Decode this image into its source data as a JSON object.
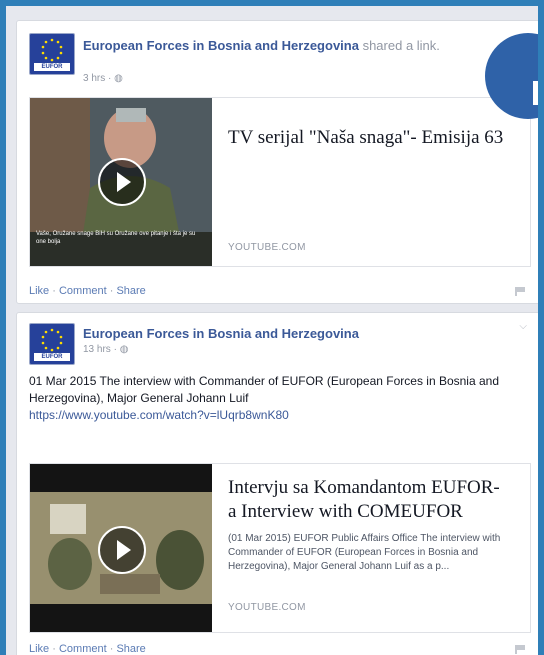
{
  "posts": [
    {
      "page_name": "European Forces in Bosnia and Herzegovina",
      "action_text": "shared a link.",
      "meta": "3 hrs · ",
      "avatar_tag": "EUFOR",
      "card": {
        "title": "TV serijal \"Naša snaga\"- Emisija 63",
        "domain": "YOUTUBE.COM",
        "thumb_caption": "Vaše, Oružane snage BiH su Oružane ove pitanje i šta je su one bolja"
      },
      "actions": {
        "like": "Like",
        "comment": "Comment",
        "share": "Share"
      }
    },
    {
      "page_name": "European Forces in Bosnia and Herzegovina",
      "meta": "13 hrs · ",
      "avatar_tag": "EUFOR",
      "body_text": "01 Mar 2015 The interview with Commander of EUFOR (European Forces in Bosnia and Herzegovina), Major General Johann Luif",
      "body_link": "https://www.youtube.com/watch?v=lUqrb8wnK80",
      "card": {
        "title_line1": "Intervju sa Komandantom EUFOR-",
        "title_line2": "a Interview with COMEUFOR",
        "description": "(01 Mar 2015) EUFOR Public Affairs Office The interview with Commander of EUFOR (European Forces in Bosnia and Herzegovina), Major General Johann Luif as a p...",
        "domain": "YOUTUBE.COM"
      },
      "actions": {
        "like": "Like",
        "comment": "Comment",
        "share": "Share"
      }
    }
  ],
  "colors": {
    "frame_blue": "#2f7fb8",
    "fb_link": "#3b5998",
    "badge": "#2f62a8"
  },
  "icons": [
    "eu-flag-icon",
    "globe-icon",
    "play-icon",
    "flag-icon",
    "chevron-down-icon"
  ]
}
